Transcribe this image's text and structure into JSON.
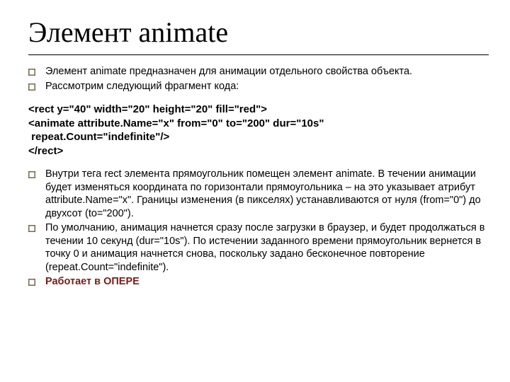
{
  "title": "Элемент animate",
  "intro": {
    "items": [
      "Элемент animate предназначен для анимации отдельного свойства объекта.",
      "Рассмотрим следующий фрагмент кода:"
    ]
  },
  "code": "<rect y=\"40\" width=\"20\" height=\"20\" fill=\"red\">\n<animate attribute.Name=\"x\" from=\"0\" to=\"200\" dur=\"10s\"\n repeat.Count=\"indefinite\"/>\n</rect>",
  "details": {
    "items": [
      "Внутри тега rect элемента прямоугольник помещен элемент animate. В течении анимации будет изменяться координата по горизонтали прямоугольника – на это указывает атрибут attribute.Name=\"x\". Границы изменения (в пикселях) устанавливаются от нуля (from=\"0\") до двухсот (to=\"200\").",
      "По умолчанию, анимация начнется сразу после загрузки в браузер, и будет продолжаться в течении 10 секунд (dur=\"10s\"). По истечении заданного времени прямоугольник вернется в точку 0 и анимация начнется снова, поскольку задано бесконечное повторение (repeat.Count=\"indefinite\").",
      "Работает в ОПЕРЕ"
    ]
  },
  "colors": {
    "bullet": "#786a4a",
    "emphasis": "#7a1b16"
  }
}
